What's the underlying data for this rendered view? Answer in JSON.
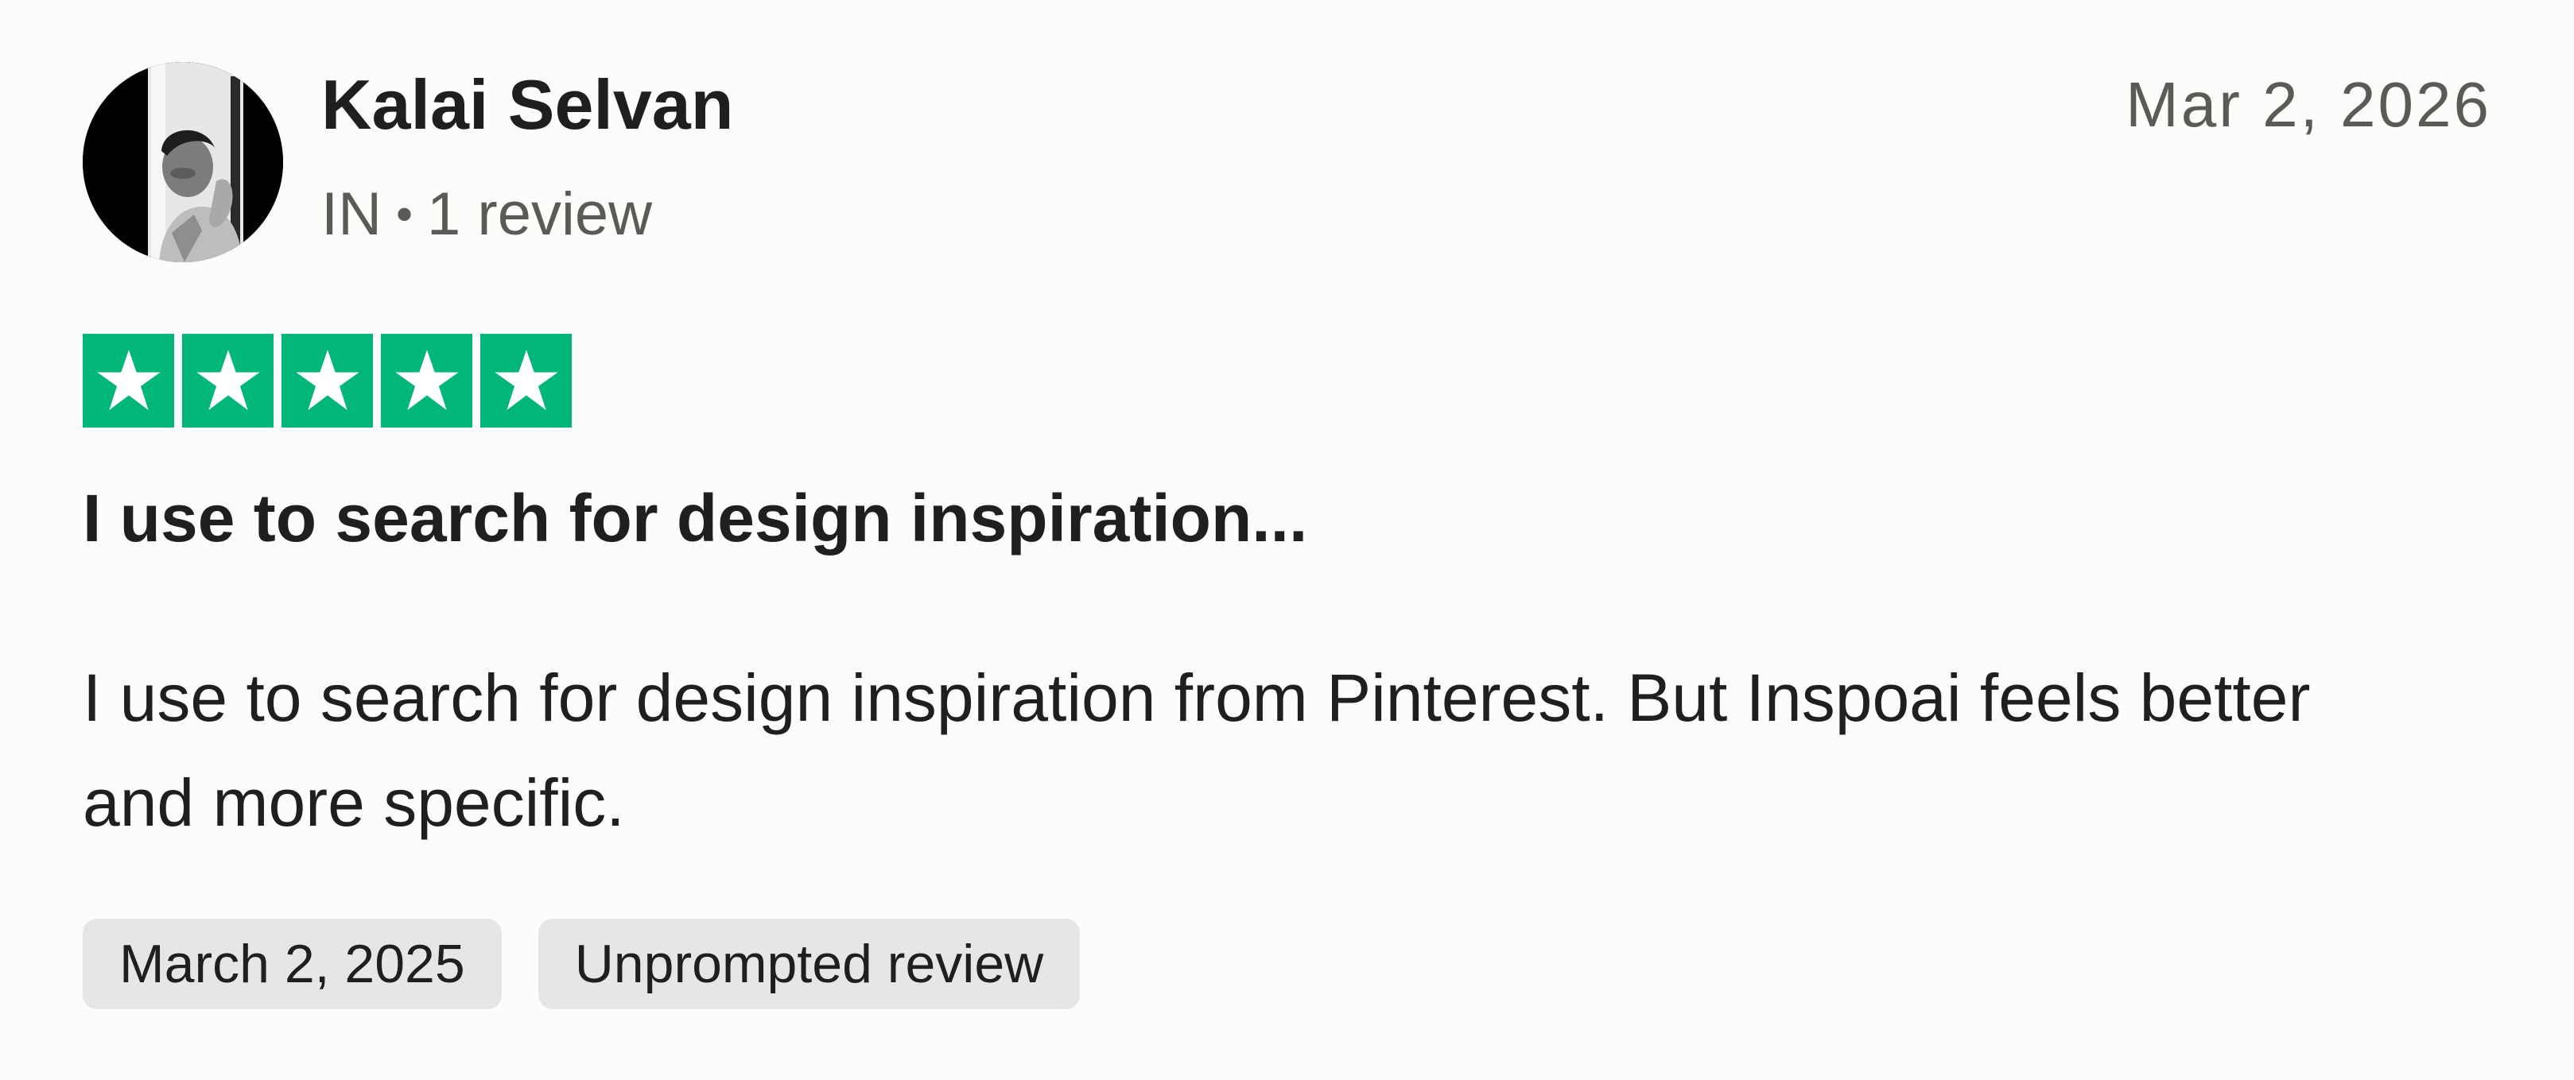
{
  "review": {
    "reviewer": {
      "name": "Kalai Selvan",
      "country": "IN",
      "separator": "•",
      "review_count": "1 review",
      "avatar": "reviewer-photo"
    },
    "date": "Mar 2, 2026",
    "rating": {
      "value": 5,
      "max": 5,
      "star_color": "#00b67a"
    },
    "title": "I use to search for design inspiration...",
    "body": "I use to search for design inspiration from Pinterest. But Inspoai feels better and more specific.",
    "tags": {
      "experience_date": "March 2, 2025",
      "review_type": "Unprompted review"
    }
  }
}
